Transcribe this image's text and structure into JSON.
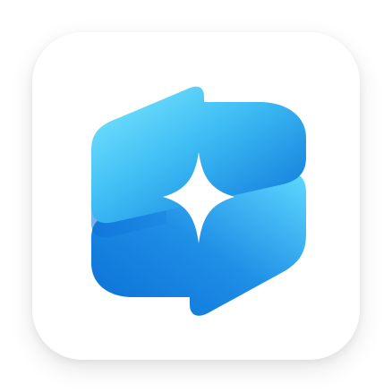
{
  "app_icon": {
    "icon": "sparkle-ribbon-logo-icon",
    "colors": {
      "tile_background": "#ffffff",
      "ribbon_light": "#7de8ff",
      "ribbon_mid": "#38b6f2",
      "ribbon_dark": "#0067d0",
      "sparkle": "#ffffff"
    }
  }
}
